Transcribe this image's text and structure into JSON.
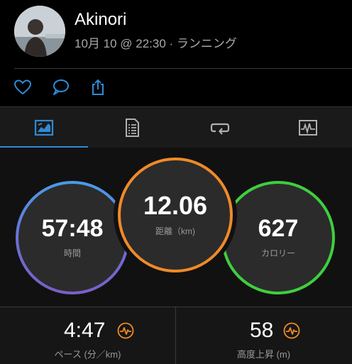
{
  "header": {
    "user_name": "Akinori",
    "activity_meta": "10月 10 @ 22:30 · ランニング"
  },
  "actions": {
    "like": "heart-icon",
    "comment": "comment-icon",
    "share": "share-icon"
  },
  "tabs": [
    {
      "icon": "stats-icon",
      "active": true
    },
    {
      "icon": "details-icon",
      "active": false
    },
    {
      "icon": "laps-icon",
      "active": false
    },
    {
      "icon": "chart-icon",
      "active": false
    }
  ],
  "metrics": {
    "time": {
      "value": "57:48",
      "label": "時間"
    },
    "distance": {
      "value": "12.06",
      "label": "距離（km)"
    },
    "calories": {
      "value": "627",
      "label": "カロリー"
    }
  },
  "stats": {
    "pace": {
      "value": "4:47",
      "label": "ペース (分／km)"
    },
    "elevation": {
      "value": "58",
      "label": "高度上昇 (m)"
    }
  },
  "colors": {
    "accent": "#2e8bd6",
    "time_ring": "#4a9ce8",
    "distance_ring": "#f08a28",
    "calories_ring": "#3ecf3e",
    "pulse_icon": "#f08a28"
  }
}
